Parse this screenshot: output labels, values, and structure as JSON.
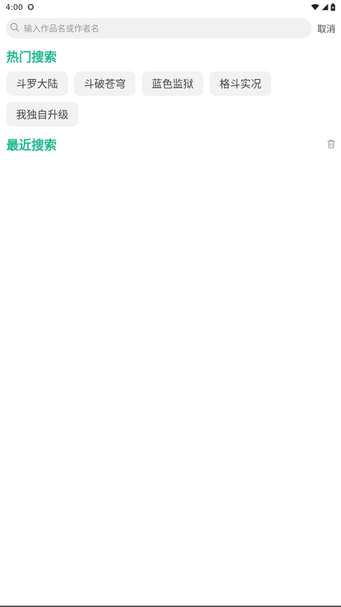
{
  "status_bar": {
    "time": "4:00"
  },
  "search": {
    "placeholder": "输入作品名或作者名",
    "cancel_label": "取消"
  },
  "hot": {
    "title": "热门搜索",
    "tags": [
      "斗罗大陆",
      "斗破苍穹",
      "蓝色监狱",
      "格斗实况",
      "我独自升级"
    ]
  },
  "recent": {
    "title": "最近搜索"
  },
  "colors": {
    "accent": "#1fb98f",
    "chip_bg": "#f2f2f2",
    "search_bg": "#f1f1f1"
  }
}
